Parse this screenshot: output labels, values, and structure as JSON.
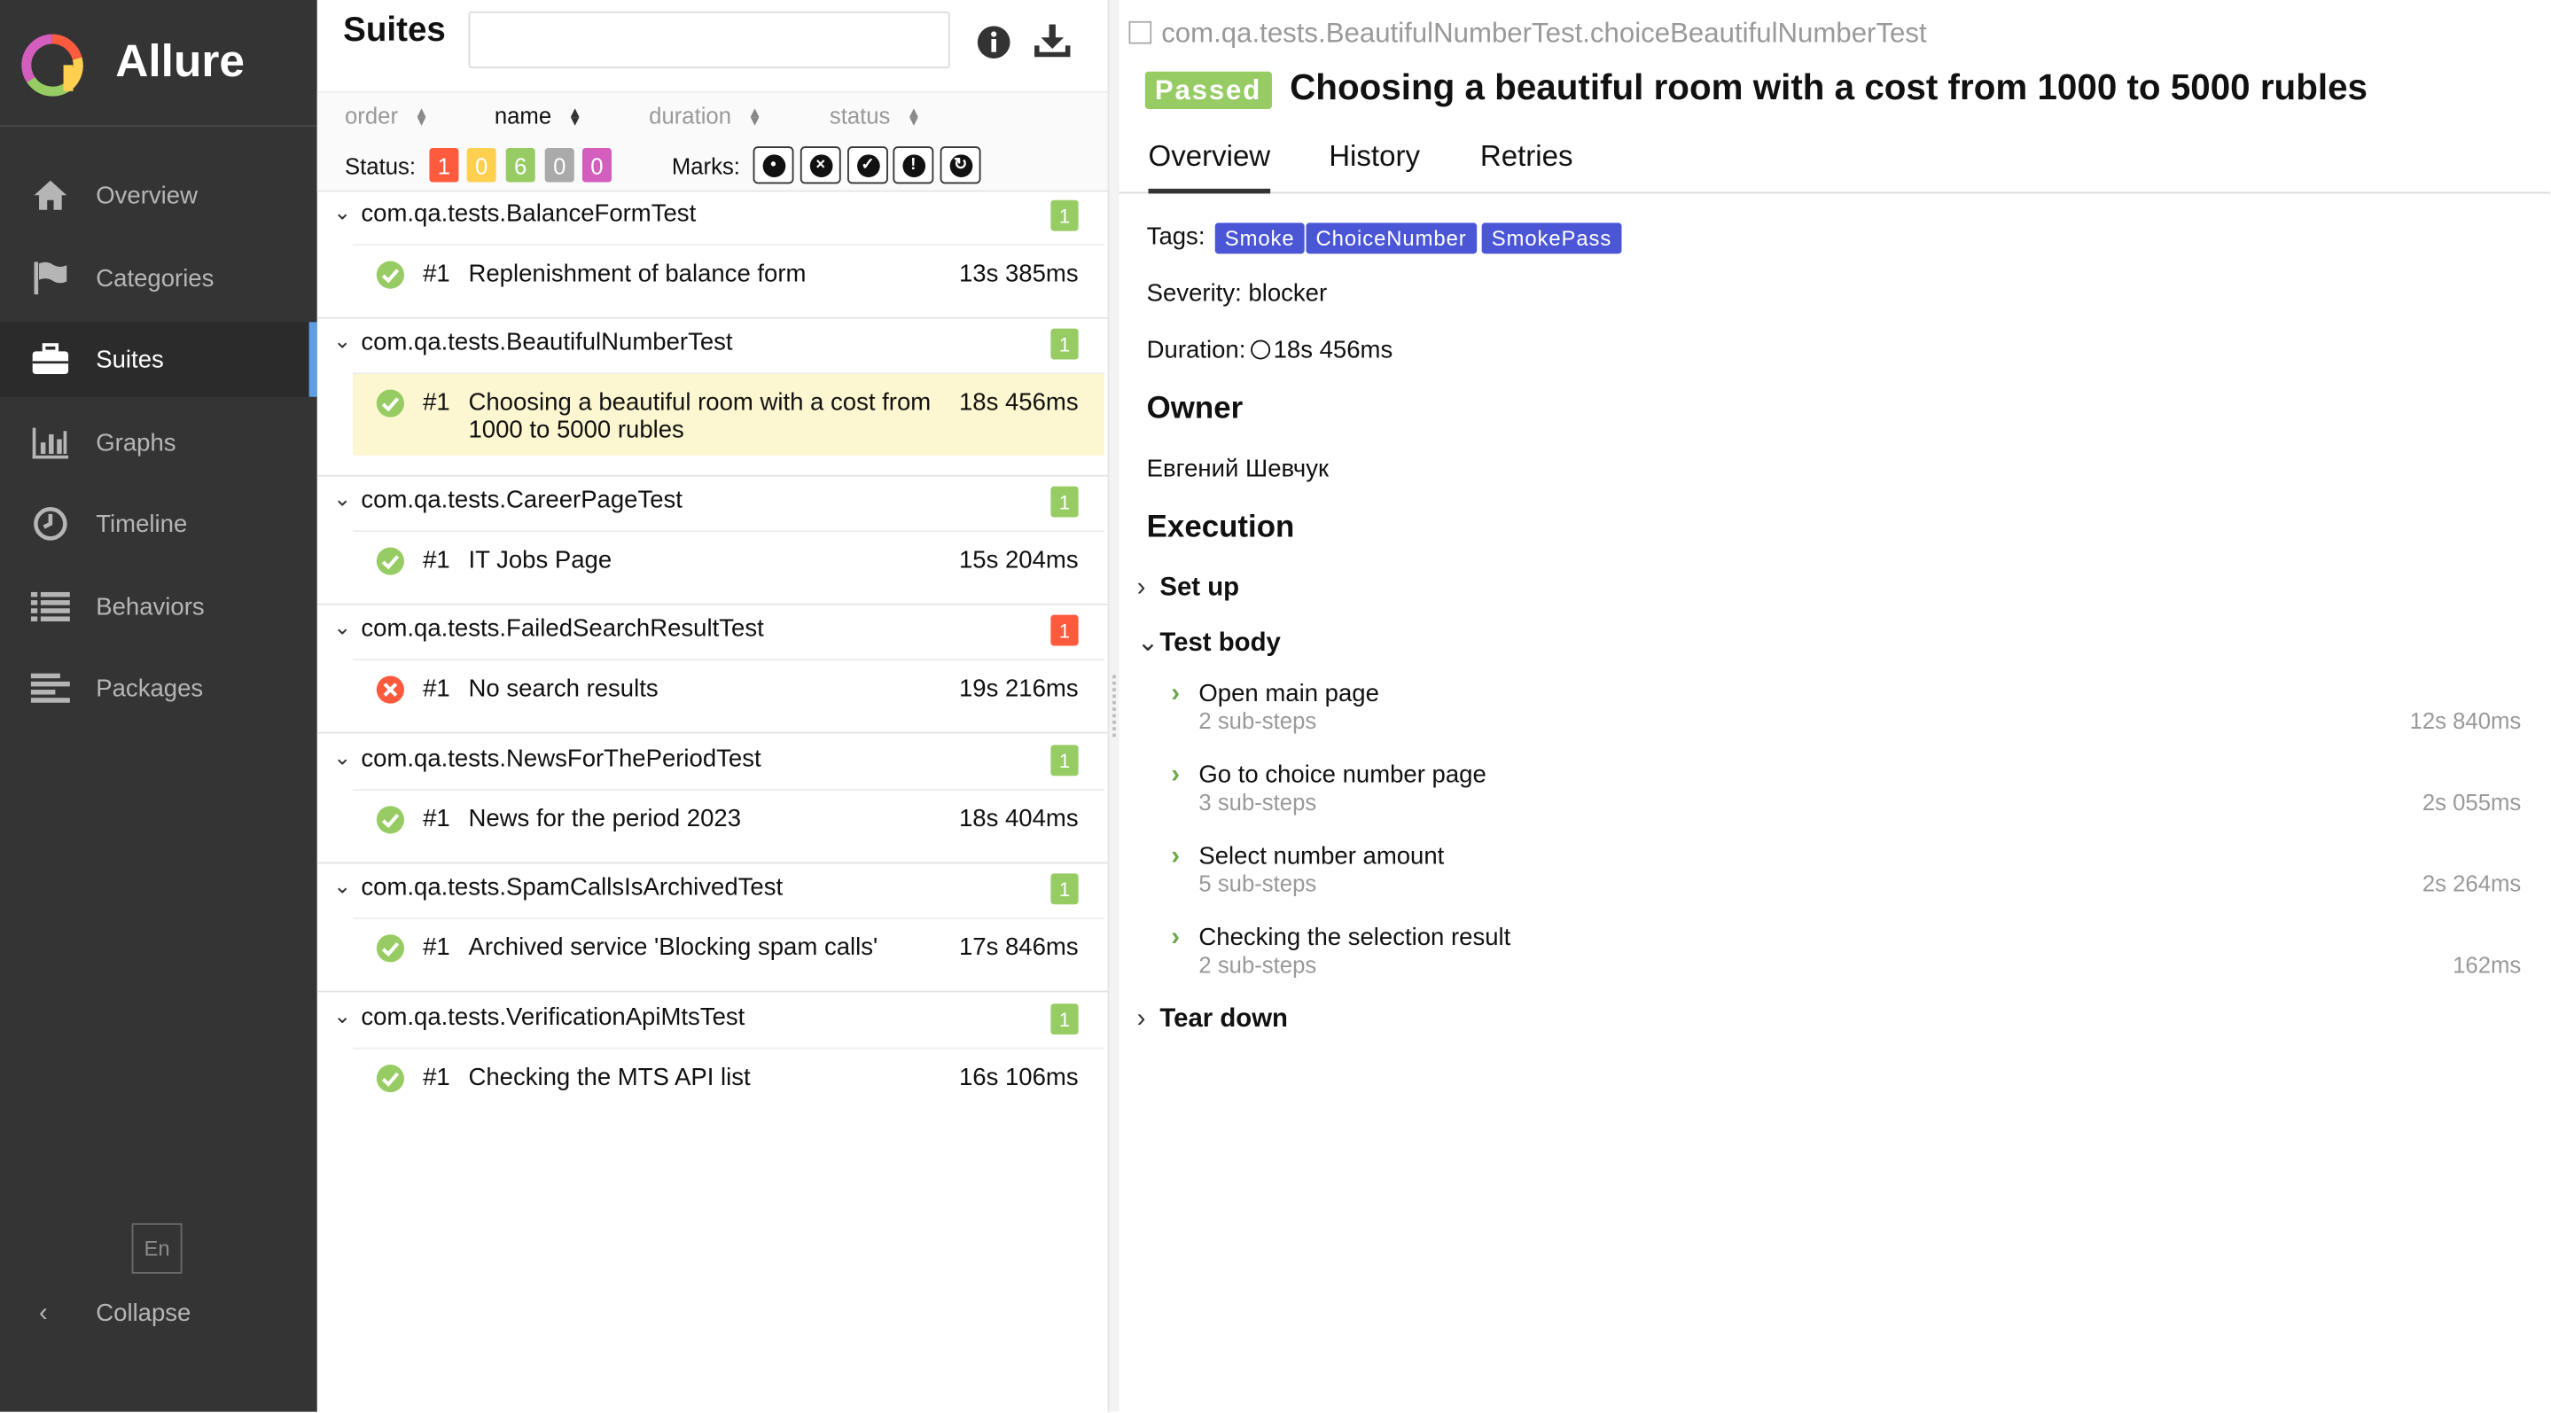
{
  "sidebar": {
    "app_name": "Allure",
    "nav": [
      {
        "label": "Overview",
        "icon": "home-icon"
      },
      {
        "label": "Categories",
        "icon": "flag-icon"
      },
      {
        "label": "Suites",
        "icon": "briefcase-icon",
        "active": true
      },
      {
        "label": "Graphs",
        "icon": "bar-chart-icon"
      },
      {
        "label": "Timeline",
        "icon": "clock-icon"
      },
      {
        "label": "Behaviors",
        "icon": "list-icon"
      },
      {
        "label": "Packages",
        "icon": "align-left-icon"
      }
    ],
    "language": "En",
    "collapse_label": "Collapse"
  },
  "suites": {
    "title": "Suites",
    "search_value": "",
    "sort": {
      "order": "order",
      "name": "name",
      "duration": "duration",
      "status": "status",
      "active": "name"
    },
    "status_label": "Status:",
    "status_counts": [
      {
        "value": "1",
        "color": "#fd5a3e"
      },
      {
        "value": "0",
        "color": "#ffd050"
      },
      {
        "value": "6",
        "color": "#97cc64"
      },
      {
        "value": "0",
        "color": "#aaaaaa"
      },
      {
        "value": "0",
        "color": "#d35ebe"
      }
    ],
    "marks_label": "Marks:",
    "marks": [
      "bomb-icon",
      "times-circle-icon",
      "check-circle-icon",
      "exclamation-circle-icon",
      "refresh-icon"
    ],
    "groups": [
      {
        "name": "com.qa.tests.BalanceFormTest",
        "count": "1",
        "count_color": "#97cc64",
        "tests": [
          {
            "num": "#1",
            "name": "Replenishment of balance form",
            "duration": "13s 385ms",
            "status": "passed"
          }
        ]
      },
      {
        "name": "com.qa.tests.BeautifulNumberTest",
        "count": "1",
        "count_color": "#97cc64",
        "tests": [
          {
            "num": "#1",
            "name": "Choosing a beautiful room with a cost from 1000 to 5000 rubles",
            "duration": "18s 456ms",
            "status": "passed",
            "selected": true
          }
        ]
      },
      {
        "name": "com.qa.tests.CareerPageTest",
        "count": "1",
        "count_color": "#97cc64",
        "tests": [
          {
            "num": "#1",
            "name": "IT Jobs Page",
            "duration": "15s 204ms",
            "status": "passed"
          }
        ]
      },
      {
        "name": "com.qa.tests.FailedSearchResultTest",
        "count": "1",
        "count_color": "#fd5a3e",
        "tests": [
          {
            "num": "#1",
            "name": "No search results",
            "duration": "19s 216ms",
            "status": "failed"
          }
        ]
      },
      {
        "name": "com.qa.tests.NewsForThePeriodTest",
        "count": "1",
        "count_color": "#97cc64",
        "tests": [
          {
            "num": "#1",
            "name": "News for the period 2023",
            "duration": "18s 404ms",
            "status": "passed"
          }
        ]
      },
      {
        "name": "com.qa.tests.SpamCallsIsArchivedTest",
        "count": "1",
        "count_color": "#97cc64",
        "tests": [
          {
            "num": "#1",
            "name": "Archived service 'Blocking spam calls'",
            "duration": "17s 846ms",
            "status": "passed"
          }
        ]
      },
      {
        "name": "com.qa.tests.VerificationApiMtsTest",
        "count": "1",
        "count_color": "#97cc64",
        "tests": [
          {
            "num": "#1",
            "name": "Checking the MTS API list",
            "duration": "16s 106ms",
            "status": "passed"
          }
        ]
      }
    ]
  },
  "detail": {
    "breadcrumb": "com.qa.tests.BeautifulNumberTest.choiceBeautifulNumberTest",
    "status": "Passed",
    "title": "Choosing a beautiful room with a cost from 1000 to 5000 rubles",
    "tabs": [
      "Overview",
      "History",
      "Retries"
    ],
    "active_tab": "Overview",
    "tags_label": "Tags:",
    "tags": [
      "Smoke",
      "ChoiceNumber",
      "SmokePass"
    ],
    "severity": "Severity: blocker",
    "duration_label": "Duration:",
    "duration_value": "18s 456ms",
    "owner_heading": "Owner",
    "owner_name": "Евгений Шевчук",
    "execution_heading": "Execution",
    "setup_label": "Set up",
    "body_label": "Test body",
    "teardown_label": "Tear down",
    "steps": [
      {
        "name": "Open main page",
        "sub": "2 sub-steps",
        "duration": "12s 840ms"
      },
      {
        "name": "Go to choice number page",
        "sub": "3 sub-steps",
        "duration": "2s 055ms"
      },
      {
        "name": "Select number amount",
        "sub": "5 sub-steps",
        "duration": "2s 264ms"
      },
      {
        "name": "Checking the selection result",
        "sub": "2 sub-steps",
        "duration": "162ms"
      }
    ]
  }
}
